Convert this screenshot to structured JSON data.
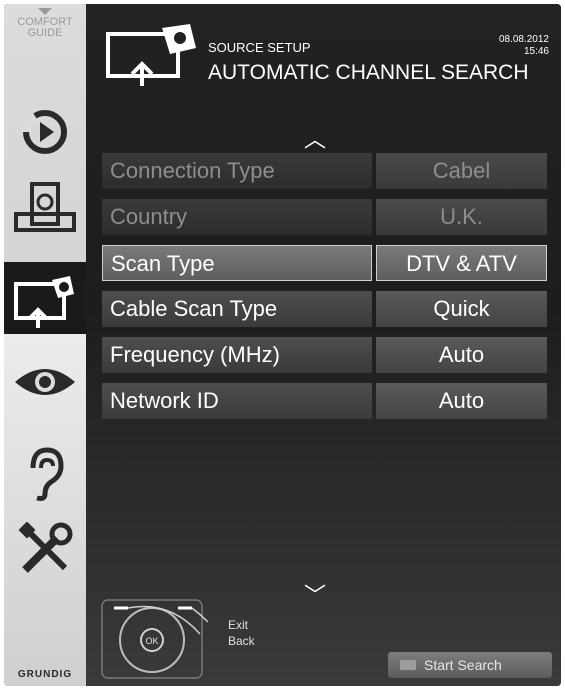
{
  "sidebar": {
    "guide_label_1": "COMFORT",
    "guide_label_2": "GUIDE",
    "brand": "GRUNDIG",
    "items": [
      {
        "icon": "playback-icon"
      },
      {
        "icon": "picture-settings-icon"
      },
      {
        "icon": "source-setup-icon",
        "active": true
      },
      {
        "icon": "eye-icon"
      },
      {
        "icon": "ear-icon"
      },
      {
        "icon": "tools-icon"
      }
    ]
  },
  "header": {
    "subtitle": "SOURCE SETUP",
    "title": "AUTOMATIC CHANNEL SEARCH",
    "date": "08.08.2012",
    "time": "15:46"
  },
  "menu": {
    "rows": [
      {
        "label": "Connection Type",
        "value": "Cabel",
        "state": "disabled"
      },
      {
        "label": "Country",
        "value": "U.K.",
        "state": "disabled"
      },
      {
        "label": "Scan Type",
        "value": "DTV & ATV",
        "state": "selected"
      },
      {
        "label": "Cable Scan Type",
        "value": "Quick",
        "state": "normal"
      },
      {
        "label": "Frequency (MHz)",
        "value": "Auto",
        "state": "normal"
      },
      {
        "label": "Network ID",
        "value": "Auto",
        "state": "normal"
      }
    ]
  },
  "footer": {
    "exit_label": "Exit",
    "back_label": "Back",
    "ok_label": "OK",
    "start_search_label": "Start Search"
  }
}
